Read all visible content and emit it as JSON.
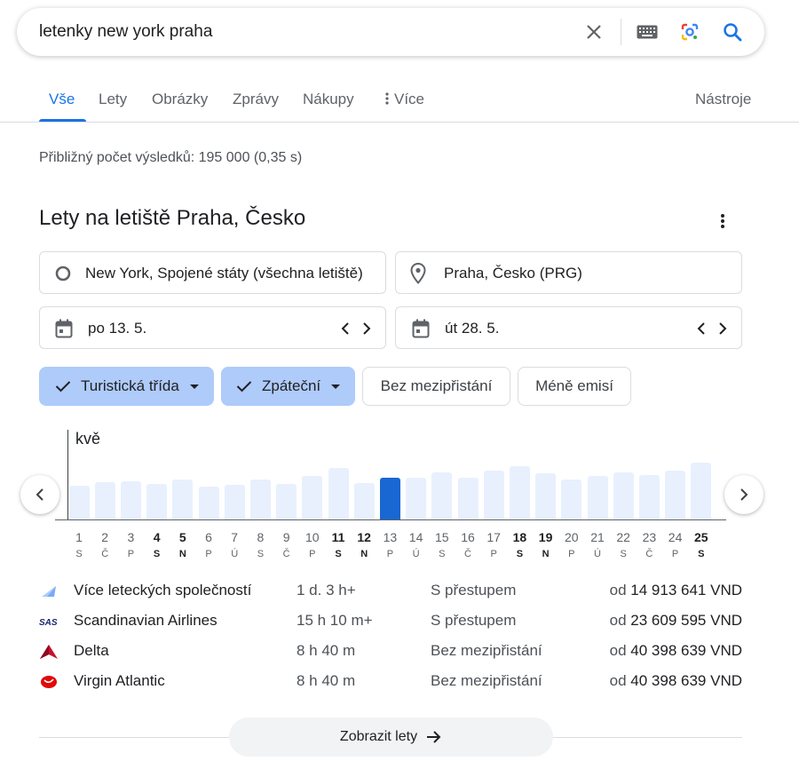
{
  "search": {
    "query": "letenky new york praha"
  },
  "tabs": [
    {
      "label": "Vše"
    },
    {
      "label": "Lety"
    },
    {
      "label": "Obrázky"
    },
    {
      "label": "Zprávy"
    },
    {
      "label": "Nákupy"
    },
    {
      "label": "Více"
    }
  ],
  "tools_label": "Nástroje",
  "result_stats": "Přibližný počet výsledků: 195 000 (0,35 s)",
  "flights": {
    "title": "Lety na letiště Praha, Česko",
    "origin": "New York, Spojené státy (všechna letiště)",
    "destination": "Praha, Česko (PRG)",
    "depart_date": "po 13. 5.",
    "return_date": "út 28. 5.",
    "chips": {
      "cabin": "Turistická třída",
      "trip": "Zpáteční",
      "nonstop": "Bez mezipřistání",
      "emissions": "Méně emisí"
    },
    "chart": {
      "month": "kvě",
      "days": [
        {
          "n": "1",
          "d": "S"
        },
        {
          "n": "2",
          "d": "Č"
        },
        {
          "n": "3",
          "d": "P"
        },
        {
          "n": "4",
          "d": "S",
          "b": true
        },
        {
          "n": "5",
          "d": "N",
          "b": true
        },
        {
          "n": "6",
          "d": "P"
        },
        {
          "n": "7",
          "d": "Ú"
        },
        {
          "n": "8",
          "d": "S"
        },
        {
          "n": "9",
          "d": "Č"
        },
        {
          "n": "10",
          "d": "P"
        },
        {
          "n": "11",
          "d": "S",
          "b": true
        },
        {
          "n": "12",
          "d": "N",
          "b": true
        },
        {
          "n": "13",
          "d": "P",
          "sel": true
        },
        {
          "n": "14",
          "d": "Ú"
        },
        {
          "n": "15",
          "d": "S"
        },
        {
          "n": "16",
          "d": "Č"
        },
        {
          "n": "17",
          "d": "P"
        },
        {
          "n": "18",
          "d": "S",
          "b": true
        },
        {
          "n": "19",
          "d": "N",
          "b": true
        },
        {
          "n": "20",
          "d": "P"
        },
        {
          "n": "21",
          "d": "Ú"
        },
        {
          "n": "22",
          "d": "S"
        },
        {
          "n": "23",
          "d": "Č"
        },
        {
          "n": "24",
          "d": "P"
        },
        {
          "n": "25",
          "d": "S",
          "b": true
        }
      ],
      "relative_prices": [
        0.53,
        0.58,
        0.6,
        0.55,
        0.63,
        0.52,
        0.54,
        0.63,
        0.56,
        0.68,
        0.81,
        0.57,
        0.65,
        0.65,
        0.74,
        0.65,
        0.76,
        0.84,
        0.72,
        0.62,
        0.68,
        0.74,
        0.69,
        0.76,
        0.89
      ]
    },
    "airlines": [
      {
        "name": "Více leteckých společností",
        "duration": "1 d. 3 h+",
        "stops": "S přestupem",
        "from": "od",
        "price": "14 913 641 VND",
        "logo": "multi-airline-icon"
      },
      {
        "name": "Scandinavian Airlines",
        "duration": "15 h 10 m+",
        "stops": "S přestupem",
        "from": "od",
        "price": "23 609 595 VND",
        "logo": "sas-logo"
      },
      {
        "name": "Delta",
        "duration": "8 h 40 m",
        "stops": "Bez mezipřistání",
        "from": "od",
        "price": "40 398 639 VND",
        "logo": "delta-logo"
      },
      {
        "name": "Virgin Atlantic",
        "duration": "8 h 40 m",
        "stops": "Bez mezipřistání",
        "from": "od",
        "price": "40 398 639 VND",
        "logo": "virgin-logo"
      }
    ],
    "show_button": "Zobrazit lety"
  },
  "colors": {
    "accent": "#1a73e8",
    "chip": "#aecbfa",
    "bar": "#e8f0fe",
    "bar_selected": "#1967d2"
  }
}
